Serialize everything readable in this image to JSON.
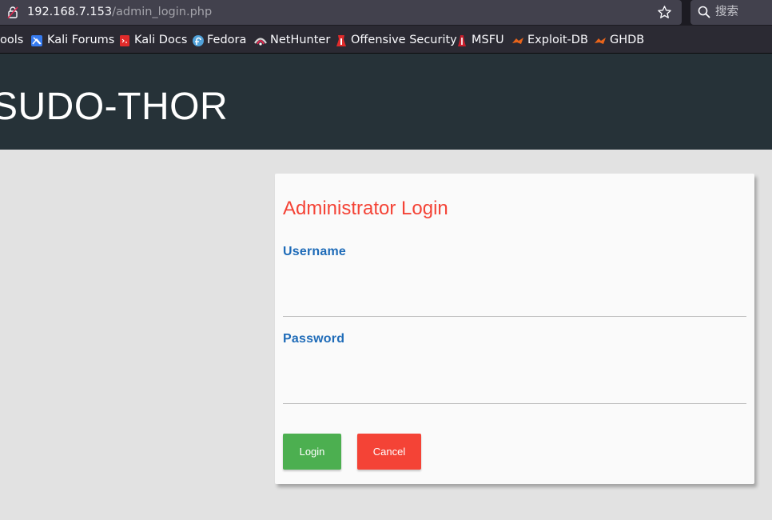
{
  "browser": {
    "url_host": "192.168.7.153",
    "url_path": "/admin_login.php",
    "search_placeholder": "搜索",
    "bookmarks": [
      {
        "label": "ools",
        "icon": "tools-icon"
      },
      {
        "label": "Kali Forums",
        "icon": "kali-forums-icon"
      },
      {
        "label": "Kali Docs",
        "icon": "kali-docs-icon"
      },
      {
        "label": "Fedora",
        "icon": "fedora-icon"
      },
      {
        "label": "NetHunter",
        "icon": "nethunter-icon"
      },
      {
        "label": "Offensive Security",
        "icon": "offensive-security-icon"
      },
      {
        "label": "MSFU",
        "icon": "msfu-icon"
      },
      {
        "label": "Exploit-DB",
        "icon": "exploit-db-icon"
      },
      {
        "label": "GHDB",
        "icon": "ghdb-icon"
      }
    ]
  },
  "site": {
    "title": "SUDO-THOR"
  },
  "login": {
    "heading": "Administrator Login",
    "username_label": "Username",
    "username_value": "",
    "password_label": "Password",
    "password_value": "",
    "login_button": "Login",
    "cancel_button": "Cancel"
  },
  "colors": {
    "header_bg": "#263238",
    "heading": "#f44336",
    "label": "#1e6bb8",
    "login_button": "#4caf50",
    "cancel_button": "#f44336",
    "page_bg": "#e2e2e2"
  }
}
